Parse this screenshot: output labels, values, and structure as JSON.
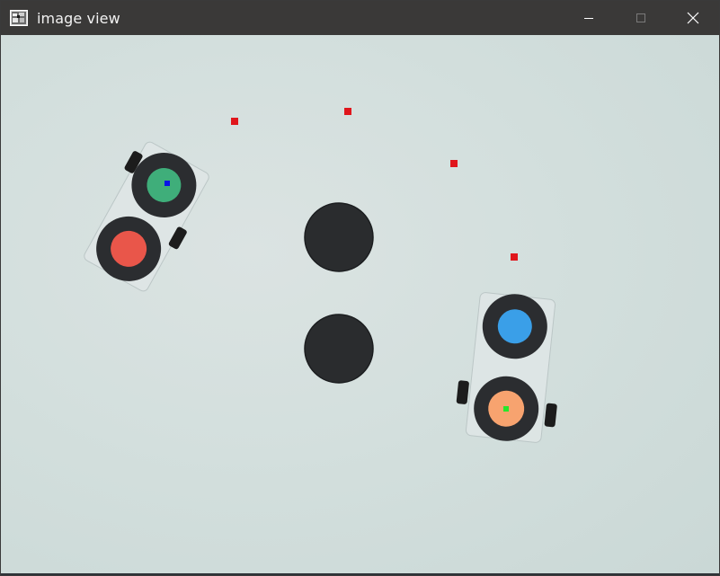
{
  "window": {
    "title": "image view",
    "icon": "image-view-app-icon",
    "controls": {
      "minimize_icon": "minimize-icon",
      "maximize_icon": "maximize-icon",
      "close_icon": "close-icon"
    },
    "colors": {
      "titlebar": "#3a3938",
      "title_text": "#f2f2f2",
      "canvas_background": "#cfdcd9"
    }
  },
  "scene": {
    "robots": [
      {
        "name": "robot-left",
        "front_wheel_color": "#3fae7a",
        "rear_wheel_color": "#e9564a",
        "center_marker_color": "#0a14e6"
      },
      {
        "name": "robot-right",
        "front_wheel_color": "#3a9fe8",
        "rear_wheel_color": "#f7a36f",
        "center_marker_color": "#27e62b"
      }
    ],
    "obstacles": [
      {
        "name": "obstacle-upper",
        "color": "#2a2c2e"
      },
      {
        "name": "obstacle-lower",
        "color": "#2a2c2e"
      }
    ],
    "waypoint_color": "#e0161c",
    "waypoint_count": 4
  }
}
